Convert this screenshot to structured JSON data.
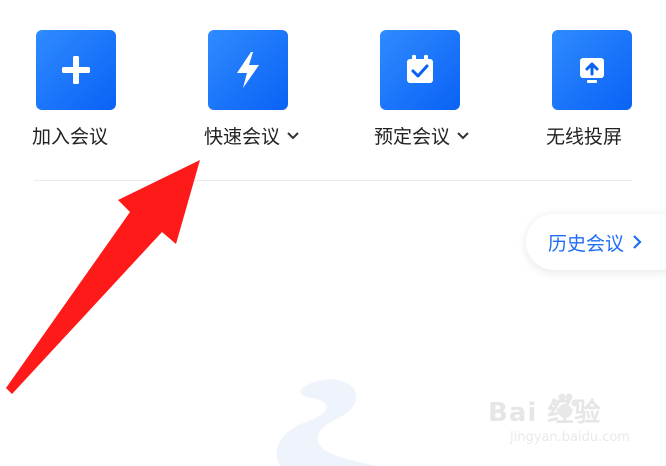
{
  "actions": [
    {
      "id": "join",
      "label": "加入会议",
      "icon": "plus-icon",
      "has_dropdown": false
    },
    {
      "id": "quick",
      "label": "快速会议",
      "icon": "lightning-icon",
      "has_dropdown": true
    },
    {
      "id": "schedule",
      "label": "预定会议",
      "icon": "calendar-check-icon",
      "has_dropdown": true
    },
    {
      "id": "share",
      "label": "无线投屏",
      "icon": "screen-share-icon",
      "has_dropdown": false
    }
  ],
  "history": {
    "label": "历史会议",
    "icon": "chevron-right-icon"
  },
  "watermark": {
    "main": "Bai 经验",
    "sub": "jingyan.baidu.com"
  },
  "colors": {
    "accent": "#1f6ef5",
    "tile": "#0a62f5",
    "arrow": "#ff1a1a"
  }
}
